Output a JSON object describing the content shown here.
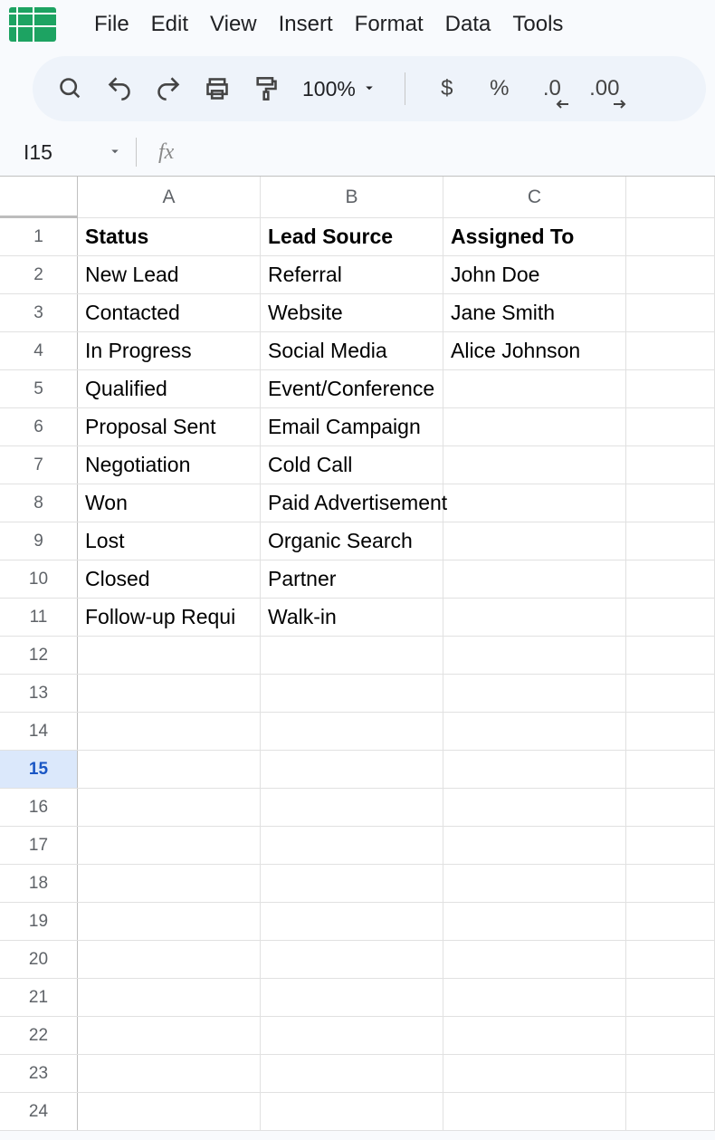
{
  "menu": [
    "File",
    "Edit",
    "View",
    "Insert",
    "Format",
    "Data",
    "Tools"
  ],
  "toolbar": {
    "zoom": "100%",
    "fmt_currency": "$",
    "fmt_percent": "%",
    "fmt_dec_dec": ".0",
    "fmt_inc_dec": ".00"
  },
  "namebox": "I15",
  "formula": "",
  "columns": [
    "A",
    "B",
    "C"
  ],
  "selected_row": 15,
  "rows": [
    {
      "n": 1,
      "a": "Status",
      "b": "Lead Source",
      "c": "Assigned To",
      "bold": true
    },
    {
      "n": 2,
      "a": "New Lead",
      "b": "Referral",
      "c": "John Doe"
    },
    {
      "n": 3,
      "a": "Contacted",
      "b": "Website",
      "c": "Jane Smith"
    },
    {
      "n": 4,
      "a": "In Progress",
      "b": "Social Media",
      "c": "Alice Johnson"
    },
    {
      "n": 5,
      "a": "Qualified",
      "b": "Event/Conference",
      "c": ""
    },
    {
      "n": 6,
      "a": "Proposal Sent",
      "b": "Email Campaign",
      "c": ""
    },
    {
      "n": 7,
      "a": "Negotiation",
      "b": "Cold Call",
      "c": ""
    },
    {
      "n": 8,
      "a": "Won",
      "b": "Paid Advertisement",
      "c": ""
    },
    {
      "n": 9,
      "a": "Lost",
      "b": "Organic Search",
      "c": ""
    },
    {
      "n": 10,
      "a": "Closed",
      "b": "Partner",
      "c": ""
    },
    {
      "n": 11,
      "a": "Follow-up Requi",
      "b": "Walk-in",
      "c": ""
    },
    {
      "n": 12,
      "a": "",
      "b": "",
      "c": ""
    },
    {
      "n": 13,
      "a": "",
      "b": "",
      "c": ""
    },
    {
      "n": 14,
      "a": "",
      "b": "",
      "c": ""
    },
    {
      "n": 15,
      "a": "",
      "b": "",
      "c": ""
    },
    {
      "n": 16,
      "a": "",
      "b": "",
      "c": ""
    },
    {
      "n": 17,
      "a": "",
      "b": "",
      "c": ""
    },
    {
      "n": 18,
      "a": "",
      "b": "",
      "c": ""
    },
    {
      "n": 19,
      "a": "",
      "b": "",
      "c": ""
    },
    {
      "n": 20,
      "a": "",
      "b": "",
      "c": ""
    },
    {
      "n": 21,
      "a": "",
      "b": "",
      "c": ""
    },
    {
      "n": 22,
      "a": "",
      "b": "",
      "c": ""
    },
    {
      "n": 23,
      "a": "",
      "b": "",
      "c": ""
    },
    {
      "n": 24,
      "a": "",
      "b": "",
      "c": ""
    }
  ]
}
